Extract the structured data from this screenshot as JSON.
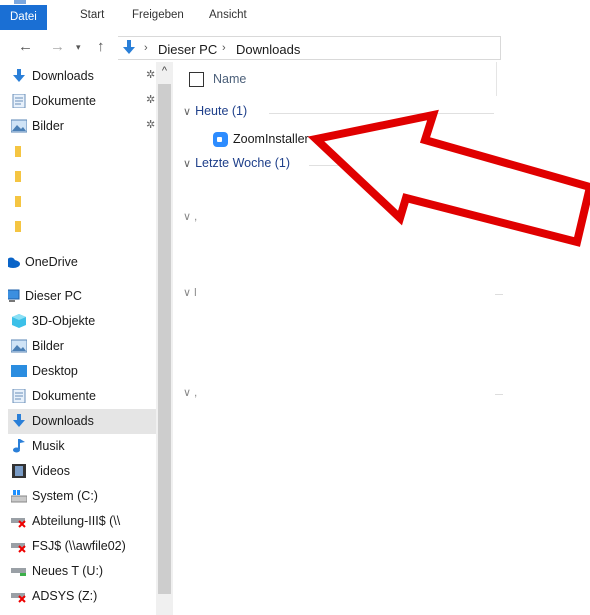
{
  "ribbon": {
    "tabs": [
      {
        "label": "Datei",
        "active": true
      },
      {
        "label": "Start",
        "active": false
      },
      {
        "label": "Freigeben",
        "active": false
      },
      {
        "label": "Ansicht",
        "active": false
      }
    ]
  },
  "address": {
    "back_icon": "back-arrow-icon",
    "crumbs": [
      "Dieser PC",
      "Downloads"
    ],
    "separator": "›"
  },
  "sidebar": {
    "items": [
      {
        "label": "Downloads",
        "icon": "download-arrow-icon",
        "pinned": true
      },
      {
        "label": "Dokumente",
        "icon": "document-icon",
        "pinned": true
      },
      {
        "label": "Bilder",
        "icon": "pictures-icon",
        "pinned": true
      },
      {
        "label": "",
        "icon": "folder-icon",
        "pinned": false
      },
      {
        "label": "",
        "icon": "folder-icon",
        "pinned": false
      },
      {
        "label": "",
        "icon": "folder-icon",
        "pinned": false
      },
      {
        "label": "",
        "icon": "folder-icon",
        "pinned": false
      },
      {
        "label": "OneDrive",
        "icon": "cloud-icon",
        "pinned": false
      },
      {
        "label": "Dieser PC",
        "icon": "computer-icon",
        "pinned": false
      },
      {
        "label": "3D-Objekte",
        "icon": "cube-icon",
        "pinned": false
      },
      {
        "label": "Bilder",
        "icon": "pictures-icon",
        "pinned": false
      },
      {
        "label": "Desktop",
        "icon": "desktop-icon",
        "pinned": false
      },
      {
        "label": "Dokumente",
        "icon": "document-icon",
        "pinned": false
      },
      {
        "label": "Downloads",
        "icon": "download-arrow-icon",
        "pinned": false,
        "selected": true
      },
      {
        "label": "Musik",
        "icon": "music-note-icon",
        "pinned": false
      },
      {
        "label": "Videos",
        "icon": "film-icon",
        "pinned": false
      },
      {
        "label": "System (C:)",
        "icon": "drive-icon",
        "pinned": false
      },
      {
        "label": "Abteilung-III$ (\\\\",
        "icon": "network-drive-disconnected-icon",
        "pinned": false
      },
      {
        "label": "FSJ$ (\\\\awfile02)",
        "icon": "network-drive-disconnected-icon",
        "pinned": false
      },
      {
        "label": "Neues T (U:)",
        "icon": "network-drive-icon",
        "pinned": false
      },
      {
        "label": "ADSYS (Z:)",
        "icon": "network-drive-disconnected-icon",
        "pinned": false
      }
    ]
  },
  "content": {
    "column_name": "Name",
    "groups": [
      {
        "label": "Heute (1)"
      },
      {
        "label": "Letzte Woche (1)"
      }
    ],
    "file": {
      "label": "ZoomInstaller",
      "icon": "zoom-app-icon"
    }
  },
  "colors": {
    "accent": "#1a6fd4",
    "group_text": "#1e3f8a",
    "annotation_arrow": "#e00000"
  }
}
